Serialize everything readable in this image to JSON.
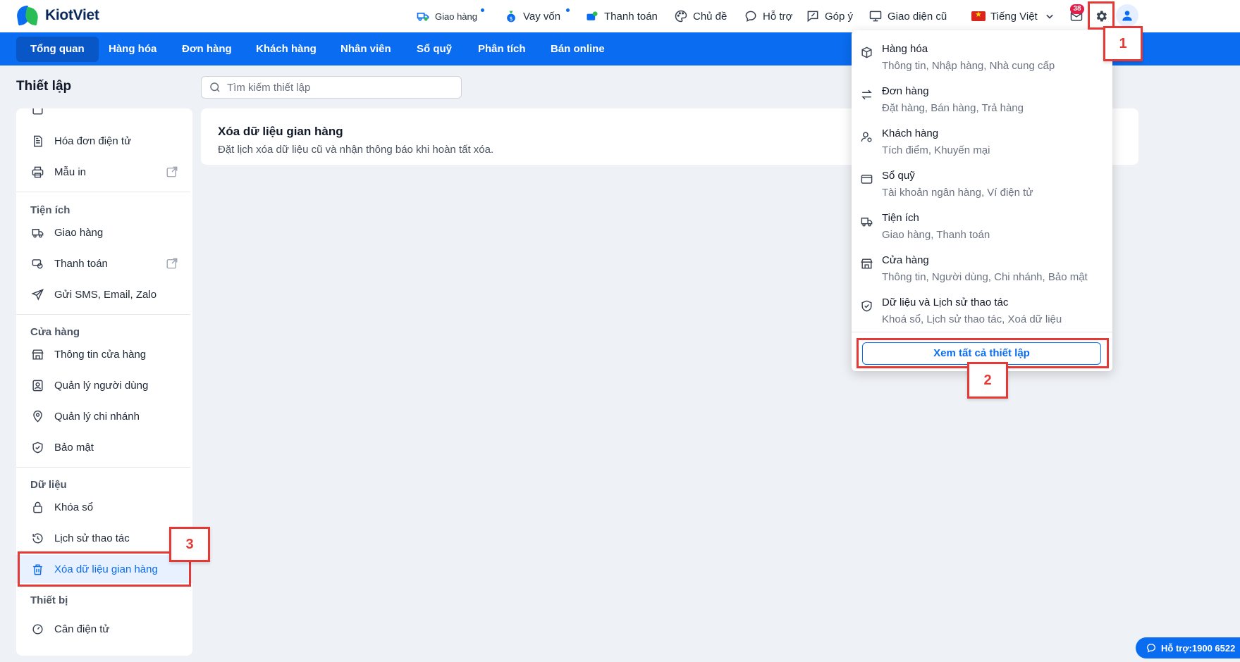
{
  "app": {
    "name": "KiotViet"
  },
  "topbar": {
    "items": [
      {
        "label": "Giao hàng",
        "icon": "delivery-icon"
      },
      {
        "label": "Vay vốn",
        "icon": "money-bag-icon"
      },
      {
        "label": "Thanh toán",
        "icon": "payment-icon"
      },
      {
        "label": "Chủ đề",
        "icon": "palette-icon"
      },
      {
        "label": "Hỗ trợ",
        "icon": "chat-bubble-icon"
      },
      {
        "label": "Góp ý",
        "icon": "feedback-icon"
      },
      {
        "label": "Giao diện cũ",
        "icon": "monitor-icon"
      }
    ],
    "language": "Tiếng Việt",
    "mail_count": "38"
  },
  "nav": {
    "items": [
      "Tổng quan",
      "Hàng hóa",
      "Đơn hàng",
      "Khách hàng",
      "Nhân viên",
      "Sổ quỹ",
      "Phân tích",
      "Bán online"
    ],
    "active": "Tổng quan"
  },
  "settings": {
    "title": "Thiết lập",
    "search_placeholder": "Tìm kiếm thiết lập",
    "sidebar": {
      "items_top": [
        "Hóa đơn điện tử",
        "Mẫu in"
      ],
      "sections": [
        {
          "title": "Tiện ích",
          "items": [
            "Giao hàng",
            "Thanh toán",
            "Gửi SMS, Email, Zalo"
          ]
        },
        {
          "title": "Cửa hàng",
          "items": [
            "Thông tin cửa hàng",
            "Quản lý người dùng",
            "Quản lý chi nhánh",
            "Bảo mật"
          ]
        },
        {
          "title": "Dữ liệu",
          "items": [
            "Khóa sổ",
            "Lịch sử thao tác",
            "Xóa dữ liệu gian hàng"
          ]
        },
        {
          "title": "Thiết bị",
          "items": [
            "Cân điện tử"
          ]
        }
      ],
      "selected": "Xóa dữ liệu gian hàng"
    },
    "card": {
      "title": "Xóa dữ liệu gian hàng",
      "description": "Đặt lịch xóa dữ liệu cũ và nhận thông báo khi hoàn tất xóa."
    }
  },
  "dropdown": {
    "items": [
      {
        "title": "Hàng hóa",
        "subtitle": "Thông tin, Nhập hàng, Nhà cung cấp",
        "icon": "box-icon"
      },
      {
        "title": "Đơn hàng",
        "subtitle": "Đặt hàng, Bán hàng, Trả hàng",
        "icon": "swap-arrows-icon"
      },
      {
        "title": "Khách hàng",
        "subtitle": "Tích điểm, Khuyến mại",
        "icon": "user-settings-icon"
      },
      {
        "title": "Sổ quỹ",
        "subtitle": "Tài khoản ngân hàng, Ví điện tử",
        "icon": "wallet-icon"
      },
      {
        "title": "Tiện ích",
        "subtitle": "Giao hàng, Thanh toán",
        "icon": "truck-icon"
      },
      {
        "title": "Cửa hàng",
        "subtitle": "Thông tin, Người dùng, Chi nhánh, Bảo mật",
        "icon": "store-icon"
      },
      {
        "title": "Dữ liệu và Lịch sử thao tác",
        "subtitle": "Khoá sổ, Lịch sử thao tác, Xoá dữ liệu",
        "icon": "shield-check-icon"
      }
    ],
    "view_all": "Xem tất cả thiết lập"
  },
  "annotations": [
    "1",
    "2",
    "3"
  ],
  "support": {
    "label": "Hỗ trợ:1900 6522"
  },
  "colors": {
    "primary": "#0a6cf0",
    "nav_active": "#0957c7",
    "highlight": "#e53935",
    "background": "#eef1f5"
  }
}
